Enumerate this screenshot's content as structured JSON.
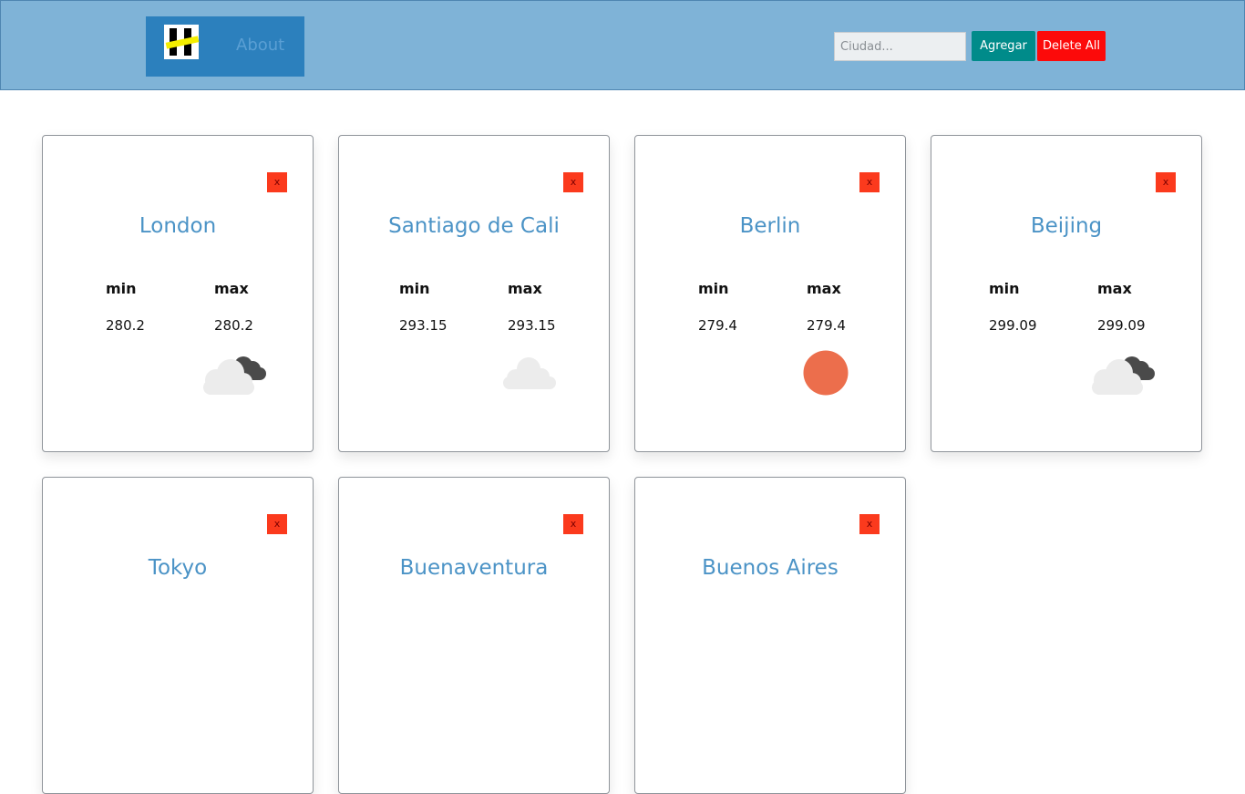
{
  "navbar": {
    "about_label": "About",
    "search_placeholder": "Ciudad...",
    "add_label": "Agregar",
    "delete_all_label": "Delete All"
  },
  "cards": [
    {
      "city": "London",
      "min_label": "min",
      "max_label": "max",
      "min": "280.2",
      "max": "280.2",
      "icon": "cloud-dark-icon",
      "close_label": "x"
    },
    {
      "city": "Santiago de Cali",
      "min_label": "min",
      "max_label": "max",
      "min": "293.15",
      "max": "293.15",
      "icon": "cloud-icon",
      "close_label": "x"
    },
    {
      "city": "Berlin",
      "min_label": "min",
      "max_label": "max",
      "min": "279.4",
      "max": "279.4",
      "icon": "sun-icon",
      "close_label": "x"
    },
    {
      "city": "Beijing",
      "min_label": "min",
      "max_label": "max",
      "min": "299.09",
      "max": "299.09",
      "icon": "cloud-dark-icon",
      "close_label": "x"
    },
    {
      "city": "Tokyo",
      "close_label": "x"
    },
    {
      "city": "Buenaventura",
      "close_label": "x"
    },
    {
      "city": "Buenos Aires",
      "close_label": "x"
    }
  ],
  "colors": {
    "navbar": "#7fb3d7",
    "brand": "#2c80bd",
    "add_button": "#008b8a",
    "delete_button": "#fc0a0a",
    "close_button": "#fb3a1d",
    "city_text": "#4b93c6",
    "sun": "#ec6e4c"
  }
}
